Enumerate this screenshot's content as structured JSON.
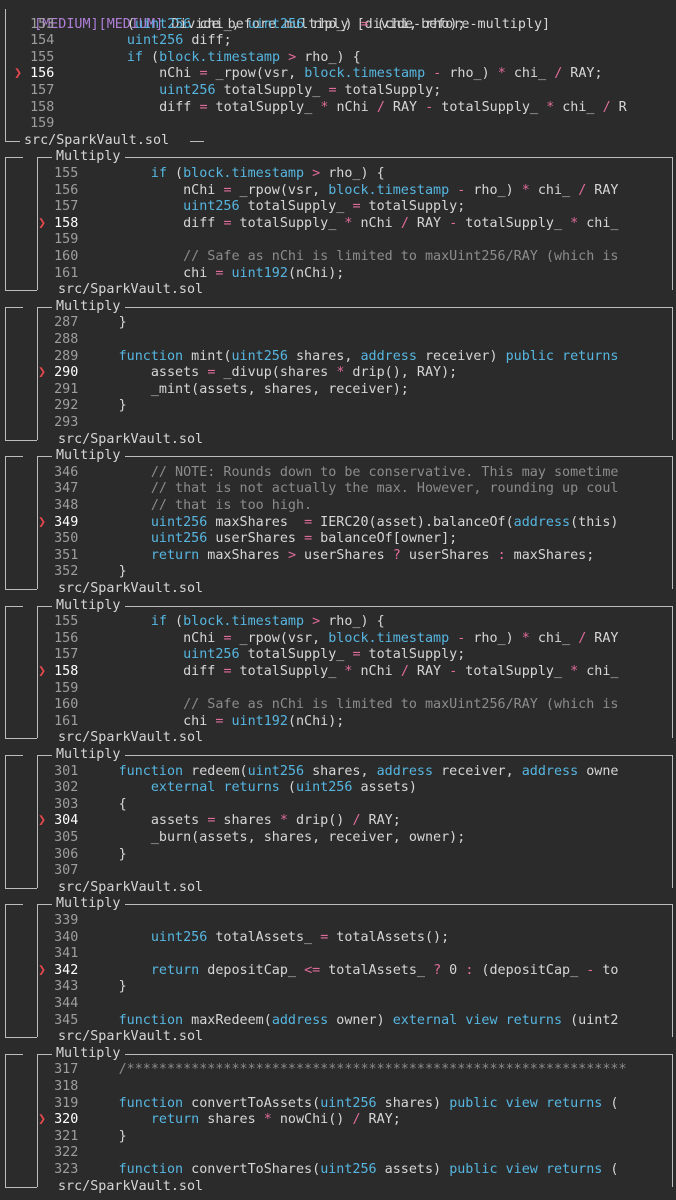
{
  "finding": {
    "tag1": "MEDIUM",
    "tag2": "MEDIUM",
    "title": "Divide before multiply [divide-before-multiply]",
    "file": "src/SparkVault.sol",
    "lines": [
      {
        "n": "153",
        "code": "        (uint256 chi_, uint256 rho_) = (chi, rho);"
      },
      {
        "n": "154",
        "code": "        uint256 diff;"
      },
      {
        "n": "155",
        "code": "        if (block.timestamp > rho_) {"
      },
      {
        "n": "156",
        "code": "            nChi = _rpow(vsr, block.timestamp - rho_) * chi_ / RAY;",
        "mark": true
      },
      {
        "n": "157",
        "code": "            uint256 totalSupply_ = totalSupply;"
      },
      {
        "n": "158",
        "code": "            diff = totalSupply_ * nChi / RAY - totalSupply_ * chi_ / R"
      },
      {
        "n": "159",
        "code": ""
      }
    ]
  },
  "marker_glyph": "❯",
  "group_label": "Multiply",
  "blocks": [
    {
      "label": "Multiply",
      "file": "src/SparkVault.sol",
      "lines": [
        {
          "n": "155",
          "code": "        if (block.timestamp > rho_) {"
        },
        {
          "n": "156",
          "code": "            nChi = _rpow(vsr, block.timestamp - rho_) * chi_ / RAY"
        },
        {
          "n": "157",
          "code": "            uint256 totalSupply_ = totalSupply;"
        },
        {
          "n": "158",
          "code": "            diff = totalSupply_ * nChi / RAY - totalSupply_ * chi_",
          "mark": true
        },
        {
          "n": "159",
          "code": ""
        },
        {
          "n": "160",
          "code": "            // Safe as nChi is limited to maxUint256/RAY (which is"
        },
        {
          "n": "161",
          "code": "            chi = uint192(nChi);"
        }
      ]
    },
    {
      "label": "Multiply",
      "file": "src/SparkVault.sol",
      "lines": [
        {
          "n": "287",
          "code": "    }"
        },
        {
          "n": "288",
          "code": ""
        },
        {
          "n": "289",
          "code": "    function mint(uint256 shares, address receiver) public returns"
        },
        {
          "n": "290",
          "code": "        assets = _divup(shares * drip(), RAY);",
          "mark": true
        },
        {
          "n": "291",
          "code": "        _mint(assets, shares, receiver);"
        },
        {
          "n": "292",
          "code": "    }"
        },
        {
          "n": "293",
          "code": ""
        }
      ]
    },
    {
      "label": "Multiply",
      "file": "src/SparkVault.sol",
      "lines": [
        {
          "n": "346",
          "code": "        // NOTE: Rounds down to be conservative. This may sometime"
        },
        {
          "n": "347",
          "code": "        // that is not actually the max. However, rounding up coul"
        },
        {
          "n": "348",
          "code": "        // that is too high."
        },
        {
          "n": "349",
          "code": "        uint256 maxShares  = IERC20(asset).balanceOf(address(this)",
          "mark": true
        },
        {
          "n": "350",
          "code": "        uint256 userShares = balanceOf[owner];"
        },
        {
          "n": "351",
          "code": "        return maxShares > userShares ? userShares : maxShares;"
        },
        {
          "n": "352",
          "code": "    }"
        }
      ]
    },
    {
      "label": "Multiply",
      "file": "src/SparkVault.sol",
      "lines": [
        {
          "n": "155",
          "code": "        if (block.timestamp > rho_) {"
        },
        {
          "n": "156",
          "code": "            nChi = _rpow(vsr, block.timestamp - rho_) * chi_ / RAY"
        },
        {
          "n": "157",
          "code": "            uint256 totalSupply_ = totalSupply;"
        },
        {
          "n": "158",
          "code": "            diff = totalSupply_ * nChi / RAY - totalSupply_ * chi_",
          "mark": true
        },
        {
          "n": "159",
          "code": ""
        },
        {
          "n": "160",
          "code": "            // Safe as nChi is limited to maxUint256/RAY (which is"
        },
        {
          "n": "161",
          "code": "            chi = uint192(nChi);"
        }
      ]
    },
    {
      "label": "Multiply",
      "file": "src/SparkVault.sol",
      "lines": [
        {
          "n": "301",
          "code": "    function redeem(uint256 shares, address receiver, address owne"
        },
        {
          "n": "302",
          "code": "        external returns (uint256 assets)"
        },
        {
          "n": "303",
          "code": "    {"
        },
        {
          "n": "304",
          "code": "        assets = shares * drip() / RAY;",
          "mark": true
        },
        {
          "n": "305",
          "code": "        _burn(assets, shares, receiver, owner);"
        },
        {
          "n": "306",
          "code": "    }"
        },
        {
          "n": "307",
          "code": ""
        }
      ]
    },
    {
      "label": "Multiply",
      "file": "src/SparkVault.sol",
      "lines": [
        {
          "n": "339",
          "code": ""
        },
        {
          "n": "340",
          "code": "        uint256 totalAssets_ = totalAssets();"
        },
        {
          "n": "341",
          "code": ""
        },
        {
          "n": "342",
          "code": "        return depositCap_ <= totalAssets_ ? 0 : (depositCap_ - to",
          "mark": true
        },
        {
          "n": "343",
          "code": "    }"
        },
        {
          "n": "344",
          "code": ""
        },
        {
          "n": "345",
          "code": "    function maxRedeem(address owner) external view returns (uint2"
        }
      ]
    },
    {
      "label": "Multiply",
      "file": "src/SparkVault.sol",
      "lines": [
        {
          "n": "317",
          "code": "    /**************************************************************"
        },
        {
          "n": "318",
          "code": ""
        },
        {
          "n": "319",
          "code": "    function convertToAssets(uint256 shares) public view returns ("
        },
        {
          "n": "320",
          "code": "        return shares * nowChi() / RAY;",
          "mark": true
        },
        {
          "n": "321",
          "code": "    }"
        },
        {
          "n": "322",
          "code": ""
        },
        {
          "n": "323",
          "code": "    function convertToShares(uint256 assets) public view returns ("
        }
      ]
    }
  ]
}
